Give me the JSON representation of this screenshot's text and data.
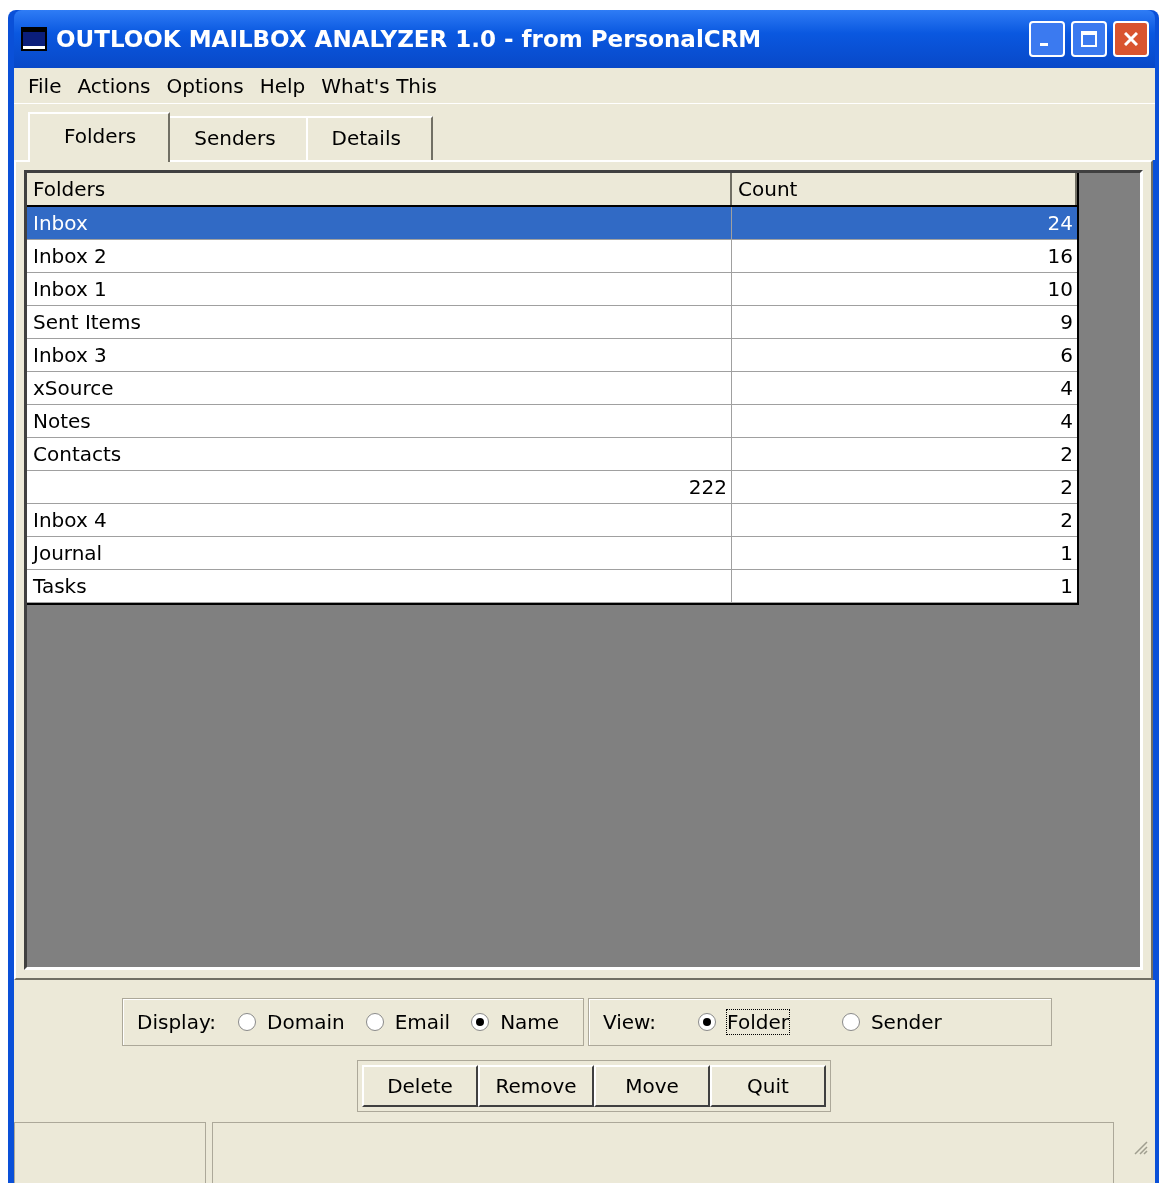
{
  "window": {
    "title": "OUTLOOK MAILBOX ANALYZER 1.0 - from PersonalCRM"
  },
  "menu": [
    "File",
    "Actions",
    "Options",
    "Help",
    "What's This"
  ],
  "tabs": [
    {
      "label": "Folders",
      "selected": true
    },
    {
      "label": "Senders",
      "selected": false
    },
    {
      "label": "Details",
      "selected": false
    }
  ],
  "table": {
    "columns": [
      "Folders",
      "Count"
    ],
    "rows": [
      {
        "folder": "Inbox",
        "count": "24",
        "selected": true,
        "folder_numeric": false
      },
      {
        "folder": "Inbox 2",
        "count": "16",
        "selected": false,
        "folder_numeric": false
      },
      {
        "folder": "Inbox 1",
        "count": "10",
        "selected": false,
        "folder_numeric": false
      },
      {
        "folder": "Sent Items",
        "count": "9",
        "selected": false,
        "folder_numeric": false
      },
      {
        "folder": "Inbox 3",
        "count": "6",
        "selected": false,
        "folder_numeric": false
      },
      {
        "folder": "xSource",
        "count": "4",
        "selected": false,
        "folder_numeric": false
      },
      {
        "folder": "Notes",
        "count": "4",
        "selected": false,
        "folder_numeric": false
      },
      {
        "folder": "Contacts",
        "count": "2",
        "selected": false,
        "folder_numeric": false
      },
      {
        "folder": "222",
        "count": "2",
        "selected": false,
        "folder_numeric": true
      },
      {
        "folder": "Inbox 4",
        "count": "2",
        "selected": false,
        "folder_numeric": false
      },
      {
        "folder": "Journal",
        "count": "1",
        "selected": false,
        "folder_numeric": false
      },
      {
        "folder": "Tasks",
        "count": "1",
        "selected": false,
        "folder_numeric": false
      }
    ]
  },
  "display": {
    "label": "Display:",
    "options": [
      {
        "label": "Domain",
        "selected": false,
        "focused": false
      },
      {
        "label": "Email",
        "selected": false,
        "focused": false
      },
      {
        "label": "Name",
        "selected": true,
        "focused": false
      }
    ]
  },
  "view": {
    "label": "View:",
    "options": [
      {
        "label": "Folder",
        "selected": true,
        "focused": true
      },
      {
        "label": "Sender",
        "selected": false,
        "focused": false
      }
    ]
  },
  "buttons": [
    "Delete",
    "Remove",
    "Move",
    "Quit"
  ]
}
